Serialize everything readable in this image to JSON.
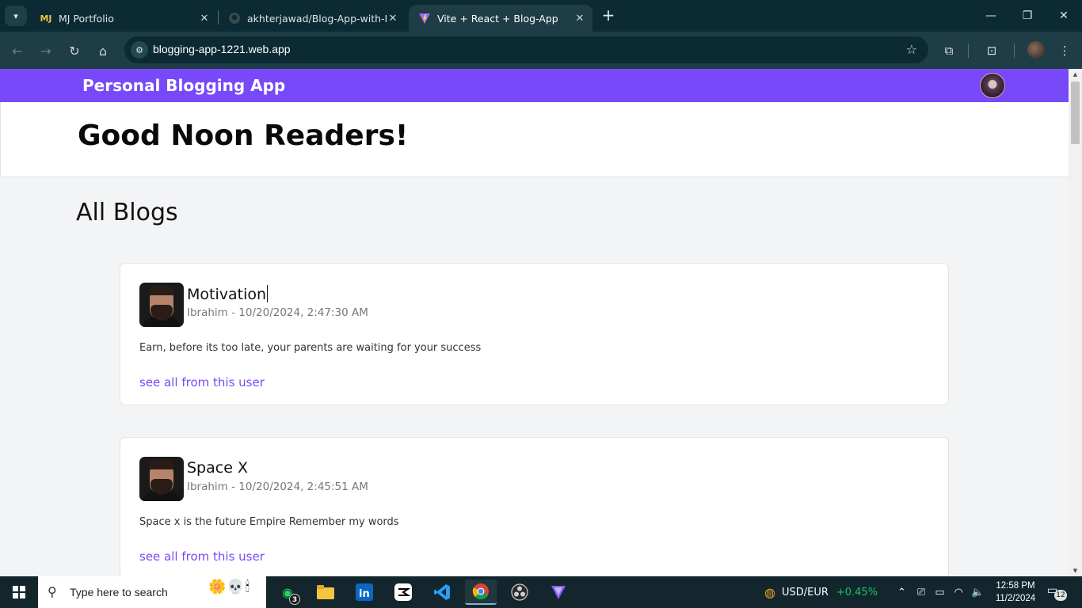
{
  "browser": {
    "tabs": [
      {
        "title": "MJ Portfolio",
        "favicon": "MJ",
        "active": false
      },
      {
        "title": "akhterjawad/Blog-App-with-Re",
        "favicon": "github-icon",
        "active": false
      },
      {
        "title": "Vite + React + Blog-App",
        "favicon": "vite-icon",
        "active": true
      }
    ],
    "url": "blogging-app-1221.web.app"
  },
  "app": {
    "brand": "Personal Blogging App",
    "greeting": "Good Noon Readers!",
    "section_title": "All Blogs",
    "accent_color": "#7749f8",
    "blogs": [
      {
        "title": "Motivation",
        "author": "Ibrahim",
        "date": "10/20/2024, 2:47:30 AM",
        "meta": "Ibrahim - 10/20/2024, 2:47:30 AM",
        "body": "Earn, before its too late, your parents are waiting for your success",
        "link": "see all from this user"
      },
      {
        "title": "Space X",
        "author": "Ibrahim",
        "date": "10/20/2024, 2:45:51 AM",
        "meta": "Ibrahim - 10/20/2024, 2:45:51 AM",
        "body": "Space x is the future Empire Remember my words",
        "link": "see all from this user"
      }
    ]
  },
  "taskbar": {
    "search_placeholder": "Type here to search",
    "whatsapp_badge": "3",
    "ticker_symbol": "USD/EUR",
    "ticker_change": "+0.45%",
    "time": "12:58 PM",
    "date": "11/2/2024",
    "notification_count": "12"
  }
}
